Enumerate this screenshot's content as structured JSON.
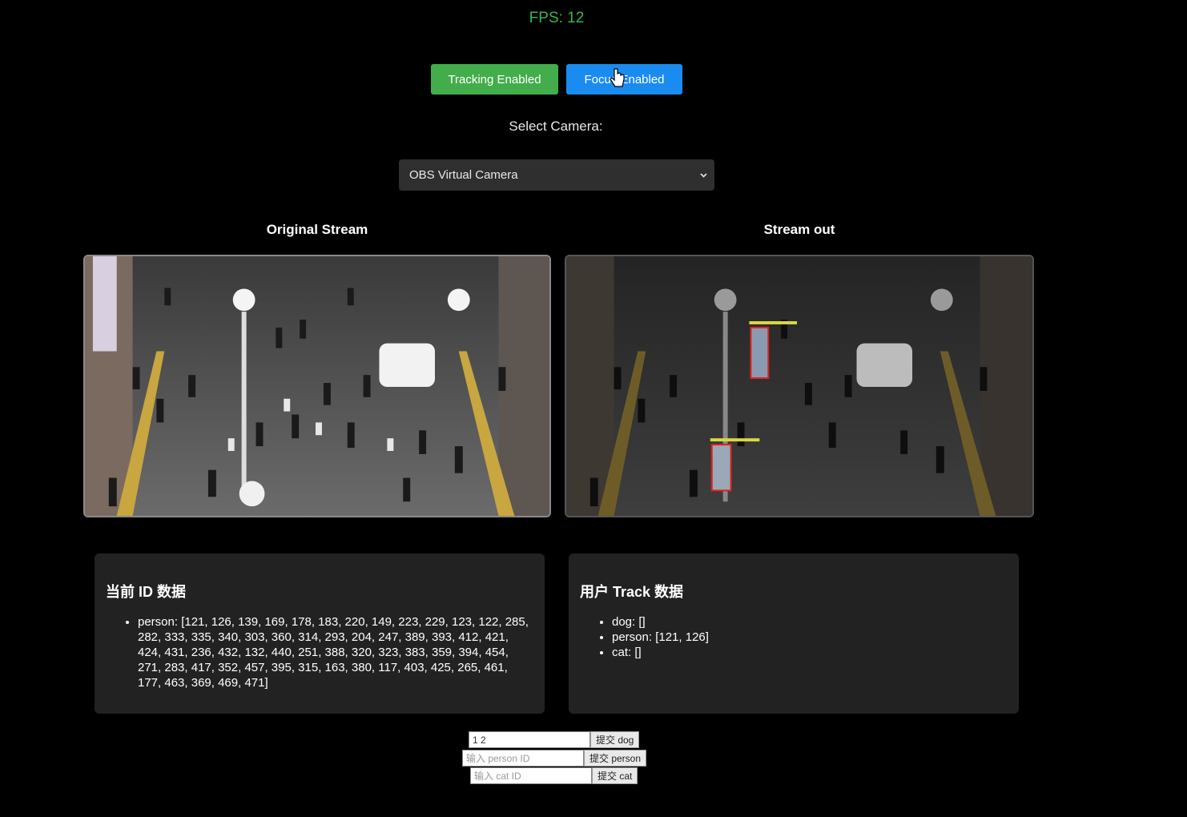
{
  "fps": "FPS: 12",
  "buttons": {
    "tracking": "Tracking Enabled",
    "focus": "Focus Enabled"
  },
  "camera": {
    "label": "Select Camera:",
    "selected": "OBS Virtual Camera"
  },
  "streams": {
    "original_title": "Original Stream",
    "out_title": "Stream out"
  },
  "id_panel": {
    "title": "当前 ID 数据",
    "items": [
      "person: [121, 126, 139, 169, 178, 183, 220, 149, 223, 229, 123, 122, 285, 282, 333, 335, 340, 303, 360, 314, 293, 204, 247, 389, 393, 412, 421, 424, 431, 236, 432, 132, 440, 251, 388, 320, 323, 383, 359, 394, 454, 271, 283, 417, 352, 457, 395, 315, 163, 380, 117, 403, 425, 265, 461, 177, 463, 369, 469, 471]"
    ]
  },
  "track_panel": {
    "title": "用户 Track 数据",
    "items": [
      "dog: []",
      "person: [121, 126]",
      "cat: []"
    ]
  },
  "forms": {
    "dog": {
      "value": "1 2",
      "placeholder": "",
      "button": "提交 dog"
    },
    "person": {
      "value": "",
      "placeholder": "输入 person ID",
      "button": "提交 person"
    },
    "cat": {
      "value": "",
      "placeholder": "输入 cat ID",
      "button": "提交 cat"
    }
  },
  "colors": {
    "fps": "#39b54a",
    "tracking_button": "#43ad4b",
    "focus_button": "#1a8cf0",
    "panel_bg": "#222222",
    "detection_box": "#e02020"
  }
}
